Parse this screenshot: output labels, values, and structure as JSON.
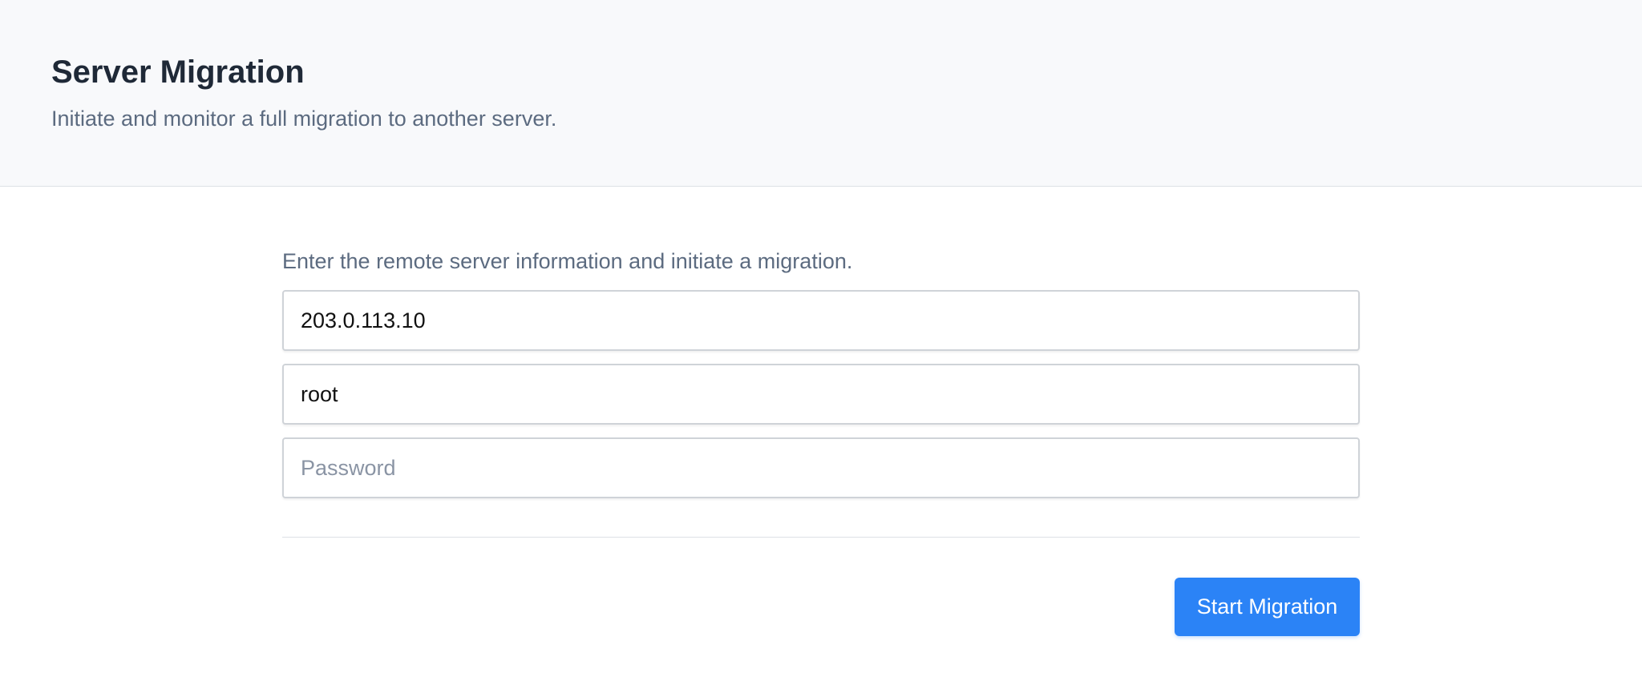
{
  "header": {
    "title": "Server Migration",
    "subtitle": "Initiate and monitor a full migration to another server."
  },
  "form": {
    "instructions": "Enter the remote server information and initiate a migration.",
    "host": {
      "value": "203.0.113.10",
      "placeholder": ""
    },
    "username": {
      "value": "root",
      "placeholder": ""
    },
    "password": {
      "value": "",
      "placeholder": "Password"
    },
    "submit_label": "Start Migration"
  },
  "colors": {
    "accent": "#2b83f6",
    "header_bg": "#f8f9fb",
    "title": "#1f2937",
    "muted_text": "#5c6b80"
  }
}
